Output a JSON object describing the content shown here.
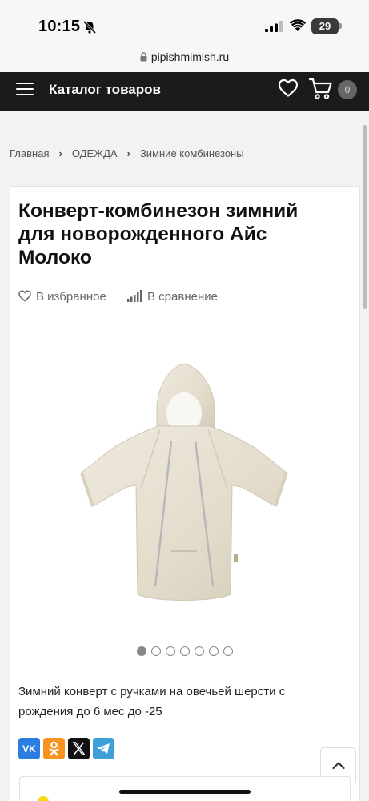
{
  "status": {
    "time": "10:15",
    "battery": "29",
    "icons": [
      "bell-slash-icon",
      "cellular-signal-icon",
      "wifi-icon",
      "battery-icon"
    ]
  },
  "browser": {
    "url": "pipishmimish.ru"
  },
  "nav": {
    "title": "Каталог товаров",
    "cart_count": "0",
    "icons": [
      "hamburger-menu-icon",
      "heart-icon",
      "cart-icon"
    ]
  },
  "breadcrumb": {
    "items": [
      "Главная",
      "ОДЕЖДА",
      "Зимние комбинезоны"
    ]
  },
  "product": {
    "title": "Конверт-комбинезон зимний для новорожденного Айс Молоко",
    "favorite_label": "В избранное",
    "compare_label": "В сравнение",
    "image_count": 7,
    "active_image_index": 0,
    "description": "Зимний конверт с ручками на овечьей шерсти с рождения до 6 мес до -25"
  },
  "share": {
    "buttons": [
      "vk-icon",
      "odnoklassniki-icon",
      "x-icon",
      "telegram-icon"
    ]
  },
  "colors": {
    "nav_bg": "#1b1b1b",
    "product_color": "#e6e0d2",
    "accent": "#f5d90a"
  }
}
